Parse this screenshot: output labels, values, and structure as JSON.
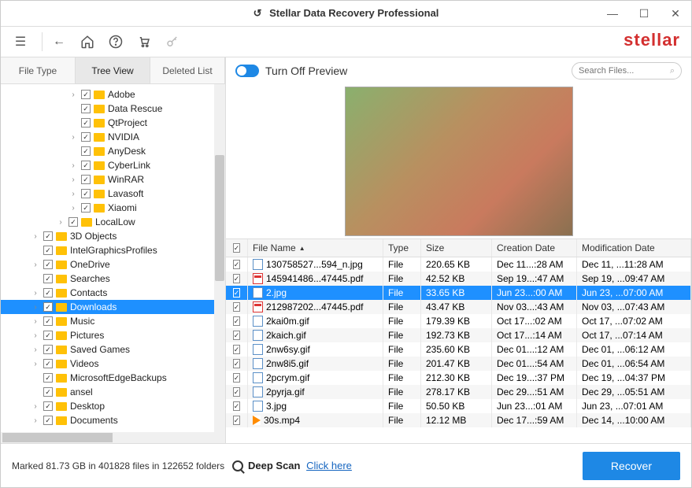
{
  "window": {
    "title": "Stellar Data Recovery Professional",
    "logo": "stellar"
  },
  "tabs": {
    "file_type": "File Type",
    "tree_view": "Tree View",
    "deleted_list": "Deleted List"
  },
  "preview": {
    "toggle_label": "Turn Off Preview"
  },
  "search": {
    "placeholder": "Search Files..."
  },
  "tree": [
    {
      "indent": 5,
      "chev": "›",
      "checked": true,
      "label": "Adobe"
    },
    {
      "indent": 5,
      "chev": "",
      "checked": true,
      "label": "Data Rescue"
    },
    {
      "indent": 5,
      "chev": "",
      "checked": true,
      "label": "QtProject"
    },
    {
      "indent": 5,
      "chev": "›",
      "checked": true,
      "label": "NVIDIA"
    },
    {
      "indent": 5,
      "chev": "",
      "checked": true,
      "label": "AnyDesk"
    },
    {
      "indent": 5,
      "chev": "›",
      "checked": true,
      "label": "CyberLink"
    },
    {
      "indent": 5,
      "chev": "›",
      "checked": true,
      "label": "WinRAR"
    },
    {
      "indent": 5,
      "chev": "›",
      "checked": true,
      "label": "Lavasoft"
    },
    {
      "indent": 5,
      "chev": "›",
      "checked": true,
      "label": "Xiaomi"
    },
    {
      "indent": 4,
      "chev": "›",
      "checked": true,
      "label": "LocalLow"
    },
    {
      "indent": 2,
      "chev": "›",
      "checked": true,
      "label": "3D Objects"
    },
    {
      "indent": 2,
      "chev": "",
      "checked": true,
      "label": "IntelGraphicsProfiles"
    },
    {
      "indent": 2,
      "chev": "›",
      "checked": true,
      "label": "OneDrive"
    },
    {
      "indent": 2,
      "chev": "",
      "checked": true,
      "label": "Searches"
    },
    {
      "indent": 2,
      "chev": "›",
      "checked": true,
      "label": "Contacts"
    },
    {
      "indent": 2,
      "chev": "›",
      "checked": true,
      "label": "Downloads",
      "selected": true
    },
    {
      "indent": 2,
      "chev": "›",
      "checked": true,
      "label": "Music"
    },
    {
      "indent": 2,
      "chev": "›",
      "checked": true,
      "label": "Pictures"
    },
    {
      "indent": 2,
      "chev": "›",
      "checked": true,
      "label": "Saved Games"
    },
    {
      "indent": 2,
      "chev": "›",
      "checked": true,
      "label": "Videos"
    },
    {
      "indent": 2,
      "chev": "",
      "checked": true,
      "label": "MicrosoftEdgeBackups"
    },
    {
      "indent": 2,
      "chev": "",
      "checked": true,
      "label": "ansel"
    },
    {
      "indent": 2,
      "chev": "›",
      "checked": true,
      "label": "Desktop"
    },
    {
      "indent": 2,
      "chev": "›",
      "checked": true,
      "label": "Documents"
    }
  ],
  "columns": {
    "name": "File Name",
    "type": "Type",
    "size": "Size",
    "cdate": "Creation Date",
    "mdate": "Modification Date"
  },
  "files": [
    {
      "checked": true,
      "icon": "img",
      "name": "130758527...594_n.jpg",
      "type": "File",
      "size": "220.65 KB",
      "cdate": "Dec 11...:28 AM",
      "mdate": "Dec 11, ...11:28 AM"
    },
    {
      "checked": true,
      "icon": "pdf",
      "name": "145941486...47445.pdf",
      "type": "File",
      "size": "42.52 KB",
      "cdate": "Sep 19...:47 AM",
      "mdate": "Sep 19, ...09:47 AM"
    },
    {
      "checked": true,
      "icon": "img",
      "name": "2.jpg",
      "type": "File",
      "size": "33.65 KB",
      "cdate": "Jun 23...:00 AM",
      "mdate": "Jun 23, ...07:00 AM",
      "selected": true
    },
    {
      "checked": true,
      "icon": "pdf",
      "name": "212987202...47445.pdf",
      "type": "File",
      "size": "43.47 KB",
      "cdate": "Nov 03...:43 AM",
      "mdate": "Nov 03, ...07:43 AM"
    },
    {
      "checked": true,
      "icon": "img",
      "name": "2kai0m.gif",
      "type": "File",
      "size": "179.39 KB",
      "cdate": "Oct 17...:02 AM",
      "mdate": "Oct 17, ...07:02 AM"
    },
    {
      "checked": true,
      "icon": "img",
      "name": "2kaich.gif",
      "type": "File",
      "size": "192.73 KB",
      "cdate": "Oct 17...:14 AM",
      "mdate": "Oct 17, ...07:14 AM"
    },
    {
      "checked": true,
      "icon": "img",
      "name": "2nw6sy.gif",
      "type": "File",
      "size": "235.60 KB",
      "cdate": "Dec 01...:12 AM",
      "mdate": "Dec 01, ...06:12 AM"
    },
    {
      "checked": true,
      "icon": "img",
      "name": "2nw8i5.gif",
      "type": "File",
      "size": "201.47 KB",
      "cdate": "Dec 01...:54 AM",
      "mdate": "Dec 01, ...06:54 AM"
    },
    {
      "checked": true,
      "icon": "img",
      "name": "2pcrym.gif",
      "type": "File",
      "size": "212.30 KB",
      "cdate": "Dec 19...:37 PM",
      "mdate": "Dec 19, ...04:37 PM"
    },
    {
      "checked": true,
      "icon": "img",
      "name": "2pyrja.gif",
      "type": "File",
      "size": "278.17 KB",
      "cdate": "Dec 29...:51 AM",
      "mdate": "Dec 29, ...05:51 AM"
    },
    {
      "checked": true,
      "icon": "img",
      "name": "3.jpg",
      "type": "File",
      "size": "50.50 KB",
      "cdate": "Jun 23...:01 AM",
      "mdate": "Jun 23, ...07:01 AM"
    },
    {
      "checked": true,
      "icon": "vid",
      "name": "30s.mp4",
      "type": "File",
      "size": "12.12 MB",
      "cdate": "Dec 17...:59 AM",
      "mdate": "Dec 14, ...10:00 AM"
    }
  ],
  "status": {
    "text": "Marked 81.73 GB in 401828 files in 122652 folders"
  },
  "deepscan": {
    "label": "Deep Scan",
    "link": "Click here"
  },
  "recover": {
    "label": "Recover"
  }
}
